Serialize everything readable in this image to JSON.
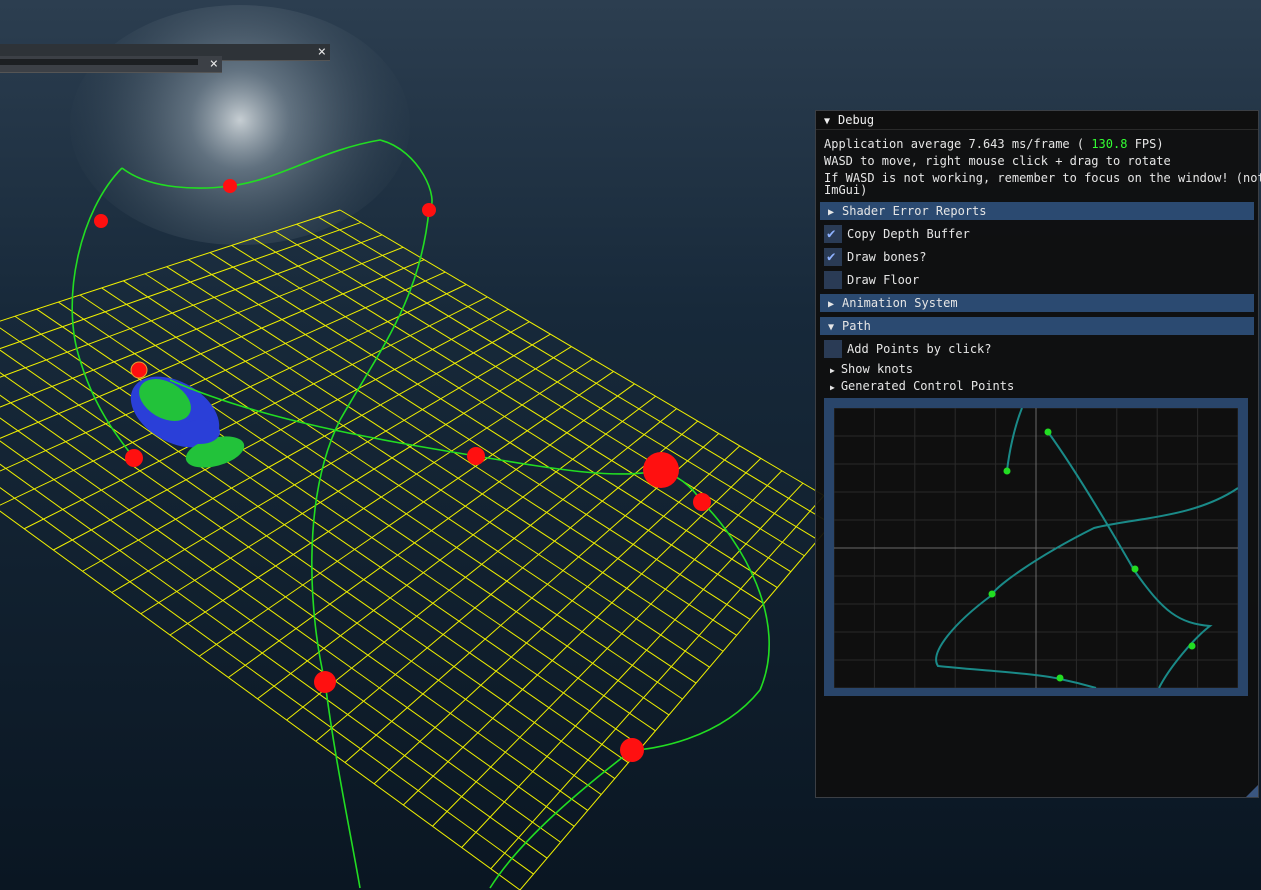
{
  "viewport": {
    "water_color": "#0e2233",
    "grid_color": "#f0f000",
    "path_color": "#22dd22",
    "knot_color": "#ff1010",
    "character_colors": [
      "#22c23a",
      "#2a3fd8"
    ]
  },
  "collapsed_windows": [
    {
      "close_label": "×"
    },
    {
      "close_label": "×"
    }
  ],
  "debug": {
    "title": "Debug",
    "stats_prefix": "Application average 7.643 ms/frame (",
    "fps": "130.8",
    "stats_suffix": "FPS)",
    "help_line1": "WASD to move, right mouse click + drag to rotate",
    "help_line2": "If WASD is not working, remember to focus on the window! (not",
    "help_line3": "ImGui)",
    "section_shader": "Shader Error Reports",
    "copy_depth": {
      "label": "Copy Depth Buffer",
      "checked": true
    },
    "draw_bones": {
      "label": "Draw bones?",
      "checked": true
    },
    "draw_floor": {
      "label": "Draw Floor",
      "checked": false
    },
    "section_animation": "Animation System",
    "section_path": "Path",
    "add_points": {
      "label": "Add Points by click?",
      "checked": false
    },
    "show_knots": "Show knots",
    "generated_control_points": "Generated Control Points",
    "check_mark": "✔",
    "accent": "#2b4a71",
    "curve_color": "#1a8a88",
    "point_color": "#22dd22"
  }
}
